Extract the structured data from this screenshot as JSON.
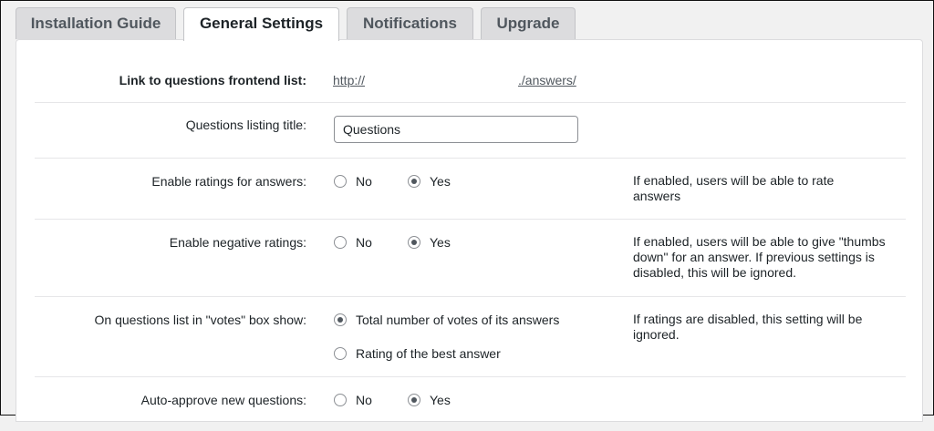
{
  "tabs": [
    {
      "label": "Installation Guide",
      "active": false
    },
    {
      "label": "General Settings",
      "active": true
    },
    {
      "label": "Notifications",
      "active": false
    },
    {
      "label": "Upgrade",
      "active": false
    }
  ],
  "settings": {
    "frontend_link": {
      "label": "Link to questions frontend list:",
      "link_start": "http://",
      "link_end": "./answers/"
    },
    "listing_title": {
      "label": "Questions listing title:",
      "value": "Questions"
    },
    "enable_ratings": {
      "label": "Enable ratings for answers:",
      "options": [
        "No",
        "Yes"
      ],
      "selected": "Yes",
      "help": "If enabled, users will be able to rate answers"
    },
    "negative_ratings": {
      "label": "Enable negative ratings:",
      "options": [
        "No",
        "Yes"
      ],
      "selected": "Yes",
      "help": "If enabled, users will be able to give \"thumbs down\" for an answer. If previous settings is disabled, this will be ignored."
    },
    "votes_box": {
      "label": "On questions list in \"votes\" box show:",
      "options": [
        "Total number of votes of its answers",
        "Rating of the best answer"
      ],
      "selected": "Total number of votes of its answers",
      "help": "If ratings are disabled, this setting will be ignored."
    },
    "auto_approve": {
      "label": "Auto-approve new questions:",
      "options": [
        "No",
        "Yes"
      ],
      "selected": "Yes"
    }
  }
}
